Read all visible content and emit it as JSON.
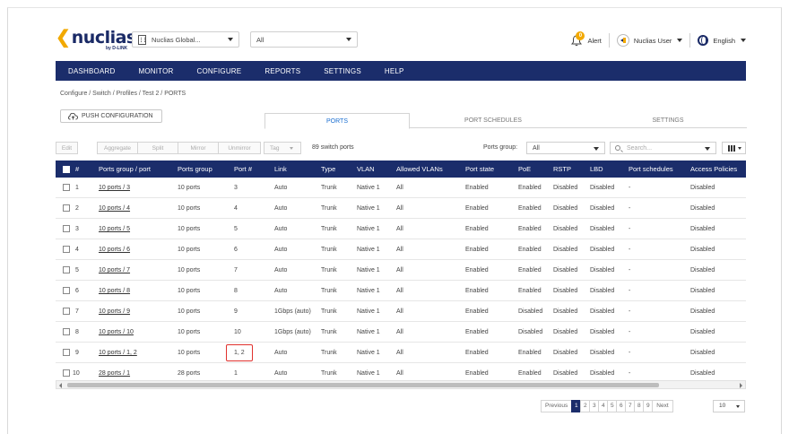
{
  "header": {
    "logo_text": "nuclias",
    "logo_sub": "by D-LINK",
    "org_select": "Nuclias Global...",
    "site_select": "All",
    "alert_count": "0",
    "alert_label": "Alert",
    "user_label": "Nuclias User",
    "language_label": "English"
  },
  "nav": [
    "DASHBOARD",
    "MONITOR",
    "CONFIGURE",
    "REPORTS",
    "SETTINGS",
    "HELP"
  ],
  "breadcrumb": "Configure / Switch / Profiles / Test 2 / PORTS",
  "push_button": "PUSH CONFIGURATION",
  "tabs": [
    "PORTS",
    "PORT SCHEDULES",
    "SETTINGS"
  ],
  "toolbar": {
    "buttons": [
      "Edit",
      "Aggregate",
      "Split",
      "Mirror",
      "Unmirror",
      "Tag"
    ],
    "count": "89 switch ports",
    "ports_group_label": "Ports group:",
    "ports_group_value": "All",
    "search_placeholder": "Search..."
  },
  "table": {
    "columns": [
      "#",
      "Ports group / port",
      "Ports group",
      "Port #",
      "Link",
      "Type",
      "VLAN",
      "Allowed VLANs",
      "Port state",
      "PoE",
      "RSTP",
      "LBD",
      "Port schedules",
      "Access Policies"
    ],
    "rows": [
      [
        "1",
        "10 ports / 3",
        "10 ports",
        "3",
        "Auto",
        "Trunk",
        "Native 1",
        "All",
        "Enabled",
        "Enabled",
        "Disabled",
        "Disabled",
        "-",
        "Disabled"
      ],
      [
        "2",
        "10 ports / 4",
        "10 ports",
        "4",
        "Auto",
        "Trunk",
        "Native 1",
        "All",
        "Enabled",
        "Enabled",
        "Disabled",
        "Disabled",
        "-",
        "Disabled"
      ],
      [
        "3",
        "10 ports / 5",
        "10 ports",
        "5",
        "Auto",
        "Trunk",
        "Native 1",
        "All",
        "Enabled",
        "Enabled",
        "Disabled",
        "Disabled",
        "-",
        "Disabled"
      ],
      [
        "4",
        "10 ports / 6",
        "10 ports",
        "6",
        "Auto",
        "Trunk",
        "Native 1",
        "All",
        "Enabled",
        "Enabled",
        "Disabled",
        "Disabled",
        "-",
        "Disabled"
      ],
      [
        "5",
        "10 ports / 7",
        "10 ports",
        "7",
        "Auto",
        "Trunk",
        "Native 1",
        "All",
        "Enabled",
        "Enabled",
        "Disabled",
        "Disabled",
        "-",
        "Disabled"
      ],
      [
        "6",
        "10 ports / 8",
        "10 ports",
        "8",
        "Auto",
        "Trunk",
        "Native 1",
        "All",
        "Enabled",
        "Enabled",
        "Disabled",
        "Disabled",
        "-",
        "Disabled"
      ],
      [
        "7",
        "10 ports / 9",
        "10 ports",
        "9",
        "1Gbps (auto)",
        "Trunk",
        "Native 1",
        "All",
        "Enabled",
        "Disabled",
        "Disabled",
        "Disabled",
        "-",
        "Disabled"
      ],
      [
        "8",
        "10 ports / 10",
        "10 ports",
        "10",
        "1Gbps (auto)",
        "Trunk",
        "Native 1",
        "All",
        "Enabled",
        "Disabled",
        "Disabled",
        "Disabled",
        "-",
        "Disabled"
      ],
      [
        "9",
        "10 ports / 1, 2",
        "10 ports",
        "1, 2",
        "Auto",
        "Trunk",
        "Native 1",
        "All",
        "Enabled",
        "Enabled",
        "Disabled",
        "Disabled",
        "-",
        "Disabled"
      ],
      [
        "10",
        "28 ports / 1",
        "28 ports",
        "1",
        "Auto",
        "Trunk",
        "Native 1",
        "All",
        "Enabled",
        "Enabled",
        "Disabled",
        "Disabled",
        "-",
        "Disabled"
      ]
    ]
  },
  "pagination": {
    "previous": "Previous",
    "pages": [
      "1",
      "2",
      "3",
      "4",
      "5",
      "6",
      "7",
      "8",
      "9"
    ],
    "current": "1",
    "next": "Next",
    "per_page": "10"
  },
  "colors": {
    "nav_bg": "#1b2d6b",
    "accent": "#1b6fd1",
    "logo_accent": "#f2a900",
    "highlight": "#e0312d"
  }
}
